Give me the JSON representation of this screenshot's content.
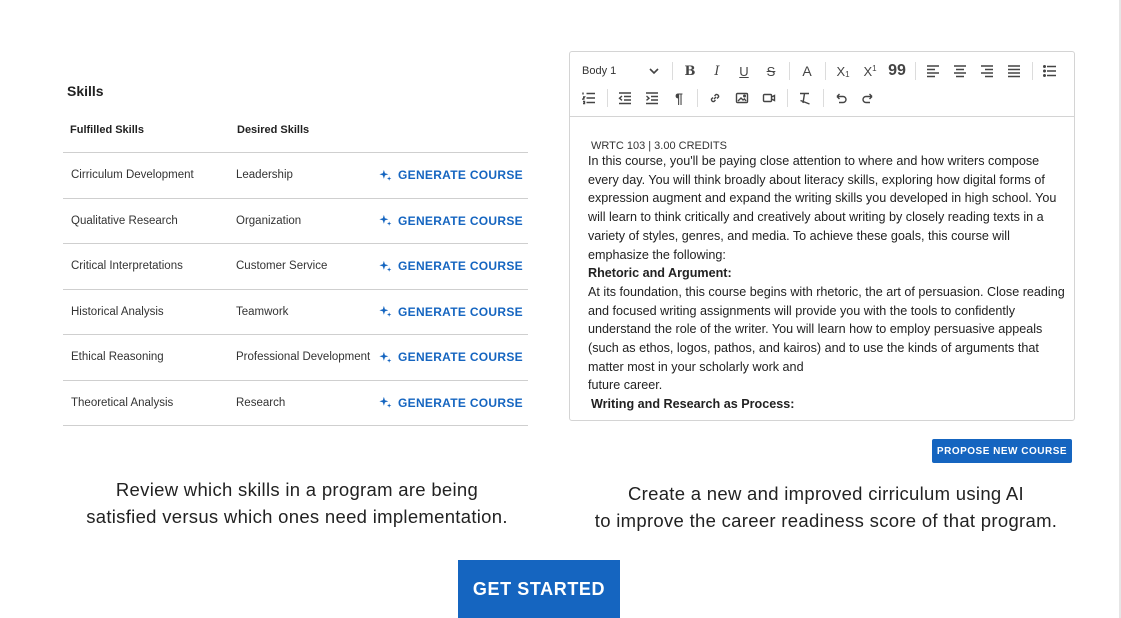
{
  "skills": {
    "title": "Skills",
    "columns": {
      "fulfilled": "Fulfilled Skills",
      "desired": "Desired Skills"
    },
    "generate_label": "GENERATE COURSE",
    "rows": [
      {
        "fulfilled": "Cirriculum Development",
        "desired": "Leadership"
      },
      {
        "fulfilled": "Qualitative Research",
        "desired": "Organization"
      },
      {
        "fulfilled": "Critical Interpretations",
        "desired": "Customer Service"
      },
      {
        "fulfilled": "Historical Analysis",
        "desired": "Teamwork"
      },
      {
        "fulfilled": "Ethical Reasoning",
        "desired": "Professional Development"
      },
      {
        "fulfilled": "Theoretical Analysis",
        "desired": "Research"
      }
    ]
  },
  "editor": {
    "style_value": "Body 1",
    "toolbar_row1": [
      "bold-icon",
      "italic-icon",
      "underline-icon",
      "strikethrough-icon",
      "font-color-icon",
      "subscript-icon",
      "superscript-icon",
      "quote-icon",
      "align-left-icon",
      "align-center-icon",
      "align-right-icon",
      "justify-icon",
      "bullet-list-icon"
    ],
    "toolbar_row2": [
      "numbered-list-icon",
      "outdent-icon",
      "indent-icon",
      "paragraph-icon",
      "link-icon",
      "image-icon",
      "video-icon",
      "clear-format-icon",
      "undo-icon",
      "redo-icon"
    ],
    "content": {
      "meta": "WRTC 103 | 3.00 CREDITS",
      "intro": "In this course, you'll be paying close attention to where and how writers compose every day. You will think broadly about literacy skills, exploring how digital forms of expression augment and expand the writing skills you developed in high school. You will learn to think critically and creatively about writing by closely reading texts in a variety  of styles, genres, and media. To achieve these goals, this course will emphasize the following:",
      "heading1": "Rhetoric and Argument:",
      "para1": "At its foundation, this course begins with rhetoric, the art of persuasion. Close reading and focused writing assignments will provide you with the tools to confidently understand the role of the writer. You will learn how to employ persuasive appeals  (such as ethos, logos, pathos, and kairos) and to use the kinds of arguments that matter most in your scholarly work and",
      "para1_end": "future career.",
      "heading2": "Writing and Research as Process:"
    }
  },
  "propose_button": "PROPOSE NEW COURSE",
  "captions": {
    "left_line1": "Review which skills in a program are being",
    "left_line2": "satisfied versus which ones need implementation.",
    "right_line1": "Create a new and improved cirriculum using AI",
    "right_line2": "to improve the career readiness score of that program."
  },
  "cta": "GET STARTED",
  "colors": {
    "accent": "#1565c0"
  }
}
